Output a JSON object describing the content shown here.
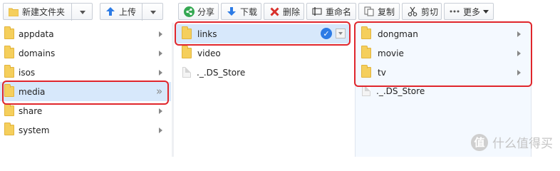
{
  "toolbar": {
    "new_folder": "新建文件夹",
    "upload": "上传",
    "share": "分享",
    "download": "下载",
    "delete": "删除",
    "rename": "重命名",
    "copy": "复制",
    "cut": "剪切",
    "more": "更多"
  },
  "col1": {
    "items": [
      {
        "label": "appdata"
      },
      {
        "label": "domains"
      },
      {
        "label": "isos"
      },
      {
        "label": "media"
      },
      {
        "label": "share"
      },
      {
        "label": "system"
      }
    ]
  },
  "col2": {
    "items": [
      {
        "label": "links"
      },
      {
        "label": "video"
      },
      {
        "label": "._.DS_Store"
      }
    ]
  },
  "col3": {
    "items": [
      {
        "label": "dongman"
      },
      {
        "label": "movie"
      },
      {
        "label": "tv"
      },
      {
        "label": "._.DS_Store"
      }
    ]
  },
  "watermark": {
    "badge": "值",
    "text": "什么值得买"
  },
  "colors": {
    "highlight": "#e0262c",
    "selection": "#d7e8fb",
    "share_green": "#35a852",
    "upload_blue": "#2d7be5",
    "delete_red": "#d9302c"
  }
}
